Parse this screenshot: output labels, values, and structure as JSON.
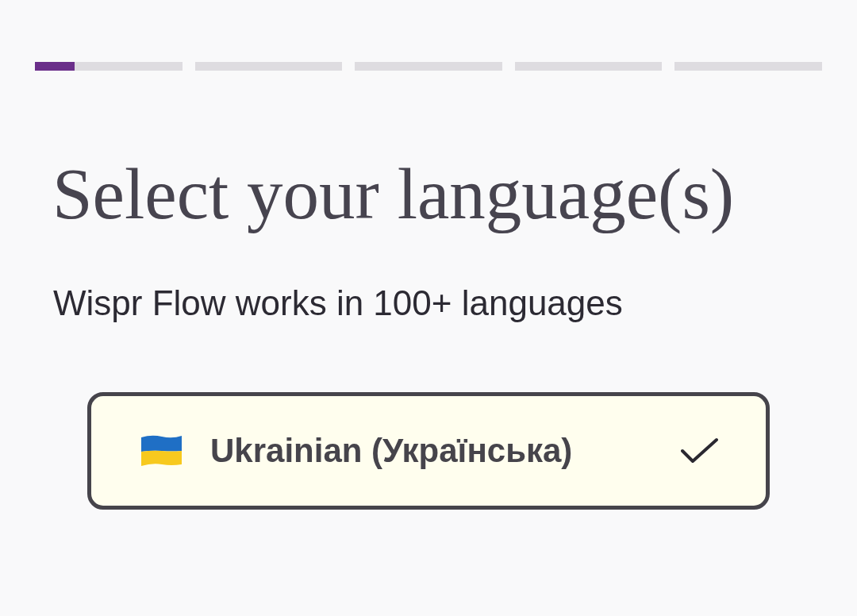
{
  "progress": {
    "level": 0.05
  },
  "title": "Select your language(s)",
  "subtitle": "Wispr Flow works in 100+ languages",
  "languages": [
    {
      "label": "Ukrainian (Українська)",
      "selected": true
    }
  ]
}
